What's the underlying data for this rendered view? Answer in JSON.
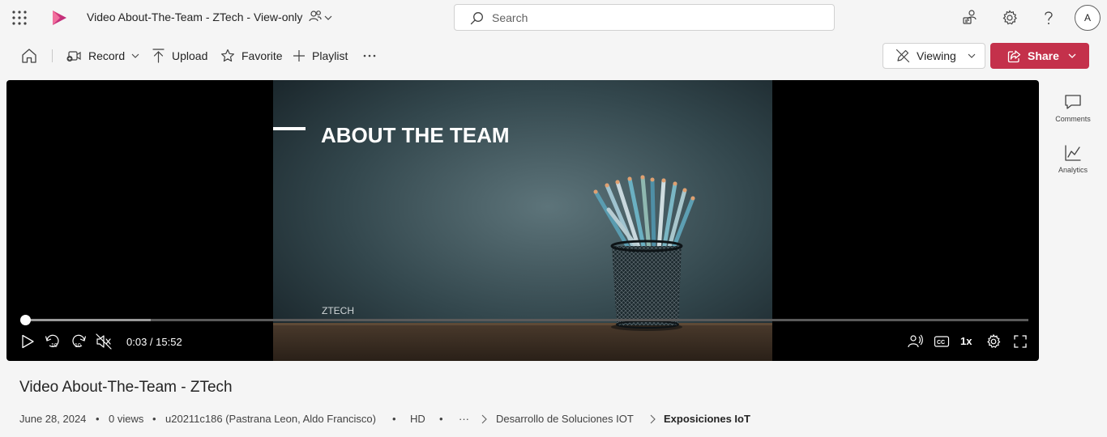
{
  "header": {
    "doc_title": "Video About-The-Team - ZTech - View-only",
    "search_placeholder": "Search",
    "avatar_initial": "A",
    "icons": [
      "app-launcher-icon",
      "stream-logo-icon",
      "people-icon",
      "search-icon",
      "feedback-icon",
      "gear-icon",
      "help-icon"
    ]
  },
  "toolbar": {
    "record_label": "Record",
    "upload_label": "Upload",
    "favorite_label": "Favorite",
    "playlist_label": "Playlist",
    "viewing_label": "Viewing",
    "share_label": "Share"
  },
  "player": {
    "slide_title": "ABOUT THE TEAM",
    "slide_watermark": "ZTECH",
    "time_display": "0:03 / 15:52",
    "skip_seconds": "10",
    "speed_label": "1x",
    "cc_label": "CC",
    "progress_fraction": 0.003,
    "buffer_fraction": 0.128
  },
  "side_panel": {
    "comments_label": "Comments",
    "analytics_label": "Analytics"
  },
  "info": {
    "title": "Video About-The-Team - ZTech",
    "date": "June 28, 2024",
    "views": "0 views",
    "owner": "u20211c186 (Pastrana Leon, Aldo Francisco)",
    "quality": "HD",
    "bullet": "•",
    "ellipsis": "···",
    "breadcrumb_parent": "Desarrollo de Soluciones IOT",
    "breadcrumb_current": "Exposiciones IoT"
  },
  "colors": {
    "accent": "#c4314b",
    "background": "#f5f5f5",
    "player_bg": "#000000"
  }
}
